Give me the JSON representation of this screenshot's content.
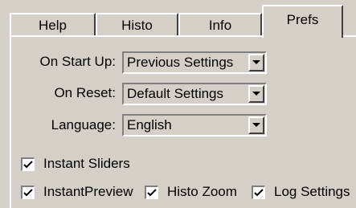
{
  "tabs": [
    {
      "label": "Help",
      "active": false
    },
    {
      "label": "Histo",
      "active": false
    },
    {
      "label": "Info",
      "active": false
    },
    {
      "label": "Prefs",
      "active": true
    }
  ],
  "settings": {
    "start_up": {
      "label": "On Start Up:",
      "value": "Previous Settings"
    },
    "reset": {
      "label": "On Reset:",
      "value": "Default Settings"
    },
    "language": {
      "label": "Language:",
      "value": "English"
    }
  },
  "checkboxes": {
    "instant_sliders": {
      "label": "Instant Sliders",
      "checked": true
    },
    "instant_preview": {
      "label": "InstantPreview",
      "checked": true
    },
    "histo_zoom": {
      "label": "Histo Zoom",
      "checked": true
    },
    "log_settings": {
      "label": "Log Settings",
      "checked": true
    }
  }
}
